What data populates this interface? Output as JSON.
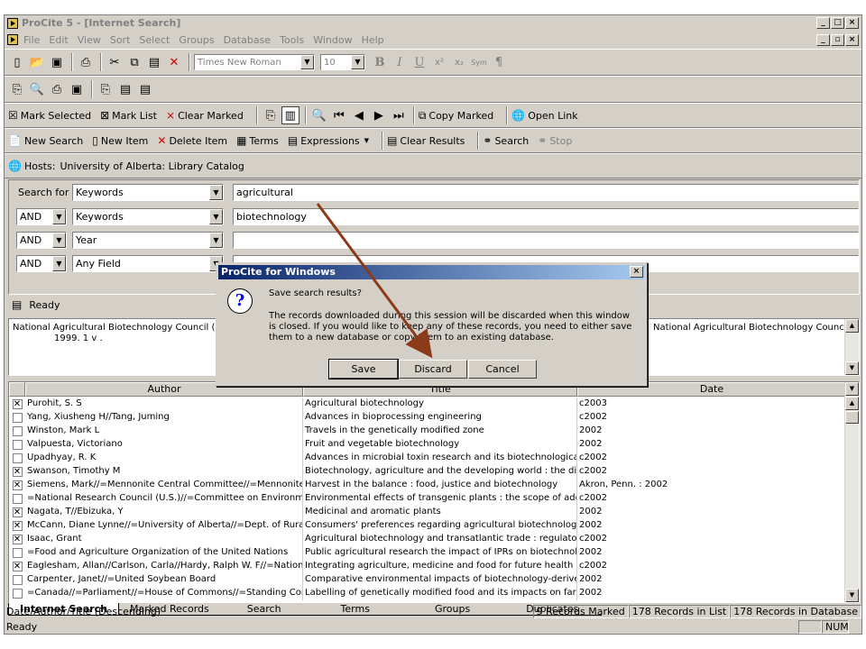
{
  "window": {
    "title": "ProCite 5 - [Internet Search]"
  },
  "menu": [
    "File",
    "Edit",
    "View",
    "Sort",
    "Select",
    "Groups",
    "Database",
    "Tools",
    "Window",
    "Help"
  ],
  "format_toolbar": {
    "font": "Times New Roman",
    "size": "10",
    "bold": "B",
    "italic": "I",
    "underline": "U",
    "sup": "x²",
    "sub": "x₂",
    "sym": "Sym",
    "para": "¶"
  },
  "mark_toolbar": {
    "mark_selected": "Mark Selected",
    "mark_list": "Mark List",
    "clear_marked": "Clear Marked",
    "copy_marked": "Copy Marked",
    "open_link": "Open Link"
  },
  "search_toolbar": {
    "new_search": "New Search",
    "new_item": "New Item",
    "delete_item": "Delete Item",
    "terms": "Terms",
    "expressions": "Expressions",
    "clear_results": "Clear Results",
    "search": "Search",
    "stop": "Stop"
  },
  "hosts": {
    "label": "Hosts:",
    "value": "University of Alberta: Library Catalog"
  },
  "search_form": {
    "search_for_label": "Search for :",
    "rows": [
      {
        "op": "",
        "field": "Keywords",
        "term": "agricultural"
      },
      {
        "op": "AND",
        "field": "Keywords",
        "term": "biotechnology"
      },
      {
        "op": "AND",
        "field": "Year",
        "term": ""
      },
      {
        "op": "AND",
        "field": "Any Field",
        "term": ""
      }
    ]
  },
  "status_ready": "Ready",
  "preview": {
    "left": "National Agricultural Biotechnology Council (U.S.). N",
    "left2": "1999. 1 v .",
    "right": "National Agricultural Biotechnology Council;"
  },
  "grid": {
    "headers": [
      "Author",
      "Title",
      "Date"
    ],
    "rows": [
      {
        "marked": true,
        "author": "Purohit, S. S",
        "title": "Agricultural biotechnology",
        "date": "c2003"
      },
      {
        "marked": false,
        "author": "Yang, Xiusheng H//Tang, Juming",
        "title": "Advances in bioprocessing engineering",
        "date": "c2002"
      },
      {
        "marked": false,
        "author": "Winston, Mark L",
        "title": "Travels in the genetically modified zone",
        "date": "2002"
      },
      {
        "marked": false,
        "author": "Valpuesta, Victoriano",
        "title": "Fruit and vegetable biotechnology",
        "date": "2002"
      },
      {
        "marked": false,
        "author": "Upadhyay, R. K",
        "title": "Advances in microbial toxin research and its biotechnological exploit",
        "date": "c2002"
      },
      {
        "marked": true,
        "author": "Swanson, Timothy M",
        "title": "Biotechnology, agriculture and the developing world : the distribution",
        "date": "c2002"
      },
      {
        "marked": true,
        "author": "Siemens, Mark//=Mennonite Central Committee//=Mennonite Centra",
        "title": "Harvest in the balance : food, justice and biotechnology",
        "date": "Akron, Penn. : 2002"
      },
      {
        "marked": false,
        "author": "=National Research Council (U.S.)//=Committee on Environmental Im",
        "title": "Environmental effects of transgenic plants : the scope of adequacy a",
        "date": "c2002"
      },
      {
        "marked": true,
        "author": "Nagata, T//Ebizuka, Y",
        "title": "Medicinal and aromatic plants",
        "date": "2002"
      },
      {
        "marked": true,
        "author": "McCann, Diane Lynne//=University of Alberta//=Dept. of Rural Econ",
        "title": "Consumers' preferences regarding agricultural biotechnology",
        "date": "2002"
      },
      {
        "marked": true,
        "author": "Isaac, Grant",
        "title": "Agricultural biotechnology and transatlantic trade : regulatory barriers",
        "date": "c2002"
      },
      {
        "marked": false,
        "author": "=Food and Agriculture Organization of the United Nations",
        "title": "Public agricultural research the impact of IPRs on biotechnology in d",
        "date": "2002"
      },
      {
        "marked": true,
        "author": "Eaglesham, Allan//Carlson, Carla//Hardy, Ralph W. F//=National Ag",
        "title": "Integrating agriculture, medicine and food for future health",
        "date": "c2002"
      },
      {
        "marked": false,
        "author": "Carpenter, Janet//=United Soybean Board",
        "title": "Comparative environmental impacts of biotechnology-derived and tra",
        "date": "2002"
      },
      {
        "marked": false,
        "author": "=Canada//=Parliament//=House of Commons//=Standing Committee",
        "title": "Labelling of genetically modified food and its impacts on farmers : rep",
        "date": "2002"
      }
    ]
  },
  "tabs": [
    "Internet Search",
    "Marked Records",
    "Search",
    "Terms",
    "Groups",
    "Duplicates"
  ],
  "statusbar": {
    "sort": "Date/Author/Title (Descending)",
    "marked": "9 Records Marked",
    "in_list": "178 Records in List",
    "in_db": "178 Records in Database",
    "ready": "Ready",
    "num": "NUM"
  },
  "dialog": {
    "title": "ProCite for Windows",
    "question": "Save search results?",
    "body": "The records downloaded during this session will be discarded when this window is closed. If you would like to keep any of these records, you need to either save them to a new database or copy them to an existing database.",
    "save": "Save",
    "discard": "Discard",
    "cancel": "Cancel"
  },
  "colors": {
    "arrow": "#8b3a1a",
    "title_active": "#0a246a",
    "face": "#d4d0c8"
  }
}
